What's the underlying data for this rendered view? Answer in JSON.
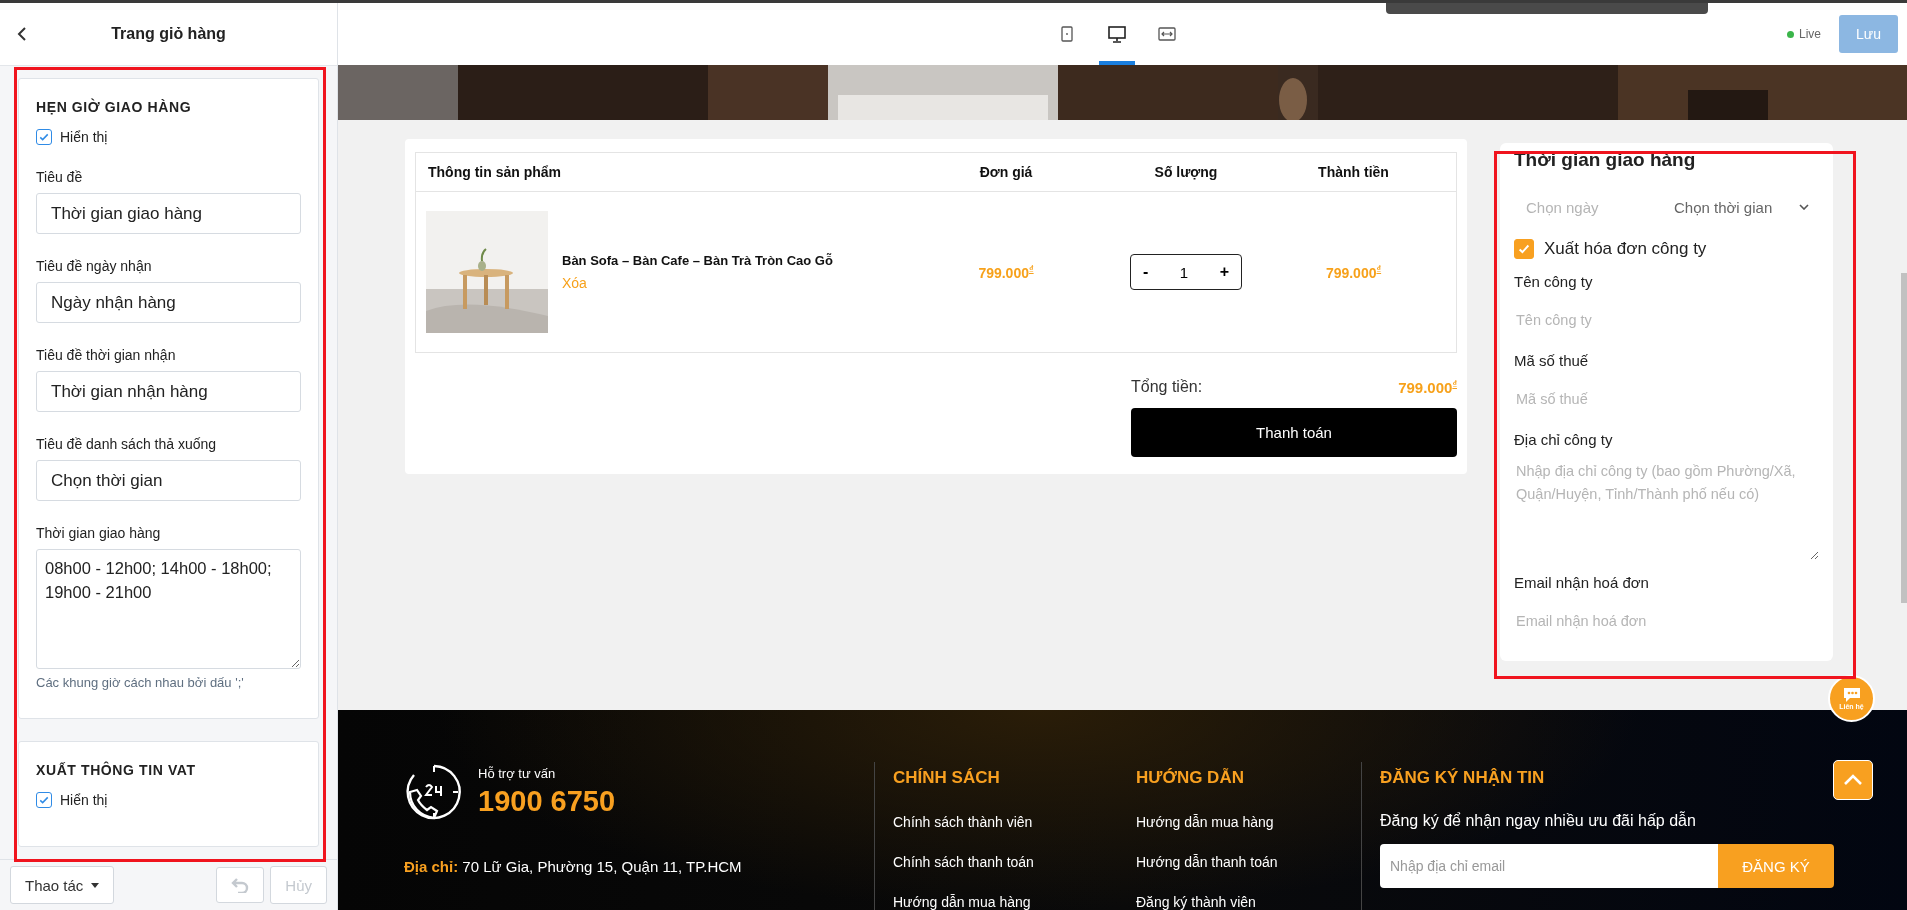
{
  "editor": {
    "title": "Trang giỏ hàng",
    "sections": [
      {
        "heading": "HẸN GIỜ GIAO HÀNG",
        "show": {
          "label": "Hiển thị",
          "checked": true
        },
        "fields": [
          {
            "kind": "input",
            "label": "Tiêu đề",
            "value": "Thời gian giao hàng"
          },
          {
            "kind": "input",
            "label": "Tiêu đề ngày nhận",
            "value": "Ngày nhận hàng"
          },
          {
            "kind": "input",
            "label": "Tiêu đề thời gian nhận",
            "value": "Thời gian nhận hàng"
          },
          {
            "kind": "input",
            "label": "Tiêu đề danh sách thả xuống",
            "value": "Chọn thời gian"
          },
          {
            "kind": "textarea",
            "label": "Thời gian giao hàng",
            "value": "08h00 - 12h00; 14h00 - 18h00; 19h00 - 21h00"
          }
        ],
        "hint": "Các khung giờ cách nhau bởi dấu ';'"
      },
      {
        "heading": "XUẤT THÔNG TIN VAT",
        "show": {
          "label": "Hiển thị",
          "checked": true
        }
      }
    ],
    "actions": {
      "menu": "Thao tác",
      "cancel": {
        "label": "Hủy",
        "disabled": true
      }
    }
  },
  "toolbar": {
    "devices": [
      {
        "kind": "mobile",
        "selected": false
      },
      {
        "kind": "desktop",
        "selected": true
      },
      {
        "kind": "fullwidth",
        "selected": false
      }
    ],
    "status": "Live",
    "save": "Lưu"
  },
  "cart": {
    "columns": [
      "Thông tin sản phẩm",
      "Đơn giá",
      "Số lượng",
      "Thành tiền"
    ],
    "rows": [
      {
        "name": "Bàn Sofa – Bàn Cafe – Bàn Trà Tròn Cao Gỗ",
        "remove": "Xóa",
        "price": "799.000$^{₫}$",
        "minus": "-",
        "quantity": "1",
        "plus": "+",
        "total": "799.000$^{₫}$"
      }
    ],
    "total_label": "Tổng tiền:",
    "total": "799.000$^{₫}$",
    "checkout": "Thanh toán"
  },
  "delivery": {
    "title": "Thời gian giao hàng",
    "date_picker": {
      "placeholder": "Chọn ngày"
    },
    "time_select": {
      "value": "Chọn thời gian"
    },
    "invoice": {
      "label": "Xuất hóa đơn công ty",
      "checked": true
    },
    "fields": [
      {
        "kind": "input",
        "label": "Tên công ty",
        "placeholder": "Tên công ty"
      },
      {
        "kind": "input",
        "label": "Mã số thuế",
        "placeholder": "Mã số thuế"
      },
      {
        "kind": "textarea",
        "label": "Địa chỉ công ty",
        "placeholder": "Nhập địa chỉ công ty (bao gồm Phường/Xã, Quận/Huyện, Tỉnh/Thành phố nếu có)"
      },
      {
        "kind": "input",
        "label": "Email nhận hoá đơn",
        "placeholder": "Email nhận hoá đơn"
      }
    ]
  },
  "footer": {
    "support_label": "Hỗ trợ tư vấn",
    "hotline": "1900 6750",
    "address": "**Địa chỉ:** 70 Lữ Gia, Phường 15, Quận 11, TP.HCM",
    "columns": [
      {
        "heading": "CHÍNH SÁCH",
        "links": [
          "Chính sách thành viên",
          "Chính sách thanh toán",
          "Hướng dẫn mua hàng"
        ]
      },
      {
        "heading": "HƯỚNG DẪN",
        "links": [
          "Hướng dẫn mua hàng",
          "Hướng dẫn thanh toán",
          "Đăng ký thành viên"
        ]
      }
    ],
    "newsletter": {
      "heading": "ĐĂNG KÝ NHẬN TIN",
      "text": "Đăng ký để nhận ngay nhiều ưu đãi hấp dẫn",
      "placeholder": "Nhập địa chỉ email",
      "button": "ĐĂNG KÝ"
    },
    "chat_label": "Liên hệ"
  }
}
